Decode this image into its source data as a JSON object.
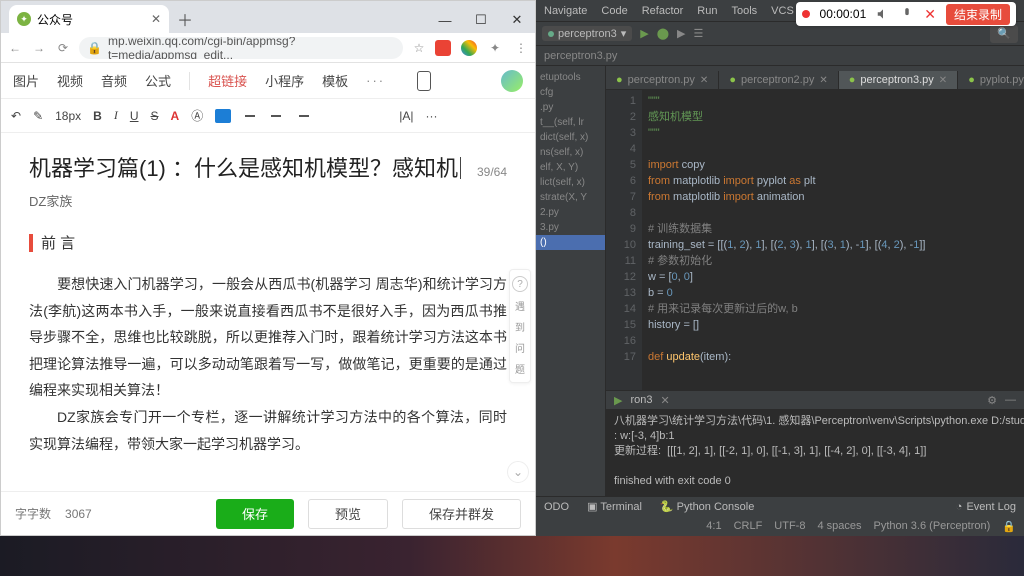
{
  "recording": {
    "time": "00:00:01",
    "stop_label": "结束录制"
  },
  "browser": {
    "tab": {
      "title": "公众号"
    },
    "url": "mp.weixin.qq.com/cgi-bin/appmsg?t=media/appmsg_edit...",
    "toolbar": {
      "image": "图片",
      "video": "视频",
      "audio": "音频",
      "formula": "公式",
      "link": "超链接",
      "miniprog": "小程序",
      "template": "模板",
      "more": "···"
    },
    "format": {
      "font_size": "18px",
      "bold": "B",
      "italic": "I",
      "underline": "U",
      "strike": "S",
      "colorA": "A",
      "more": "···"
    },
    "doc": {
      "title": "机器学习篇(1) ：什么是感知机模型？感知机",
      "counter": "39/64",
      "author": "DZ家族",
      "section": "前 言",
      "p1_a": "要想快速入门机器学习，一般会从西瓜书(机器学习 周志华)和统计学习方法(李航)这两本书入手，一般来说直接看西瓜书不是很好入手，因为西瓜书推导步骤不全，思维也比较跳脱，所以更推荐入门时，跟着统计学习方法这本书把理论算法推导一遍，可以多动动笔跟着写一写，做做笔记，更重要的是通过编程来实现相关算法！",
      "p1_b": "DZ家族会专门开一个专栏，逐一讲解统计学习方法中的各个算法，同时实现算法编程，带领大家一起学习机器学习。",
      "sidebar": {
        "q": "?",
        "t1": "遇",
        "t2": "到",
        "t3": "问",
        "t4": "题"
      }
    },
    "bottom": {
      "wc_label": "字字数",
      "wc": "3067",
      "save": "保存",
      "preview": "预览",
      "save_send": "保存并群发"
    }
  },
  "ide": {
    "menus": [
      "Navigate",
      "Code",
      "Refactor",
      "Run",
      "Tools",
      "VCS"
    ],
    "run_config": "perceptron3",
    "breadcrumb": "perceptron3.py",
    "project_items": [
      "etuptools",
      "cfg",
      ".py",
      "t__(self, lr",
      "dict(self, x)",
      "ns(self, x)",
      "elf, X, Y)",
      "lict(self, x)",
      "strate(X, Y",
      "2.py",
      "3.py",
      "()"
    ],
    "project_selected_index": 11,
    "tabs": [
      {
        "name": "perceptron.py",
        "active": false
      },
      {
        "name": "perceptron2.py",
        "active": false
      },
      {
        "name": "perceptron3.py",
        "active": true
      },
      {
        "name": "pyplot.py",
        "active": false
      }
    ],
    "code": {
      "line_start": 1,
      "lines": [
        {
          "t": "doc",
          "v": "\"\"\""
        },
        {
          "t": "doc",
          "v": "感知机模型"
        },
        {
          "t": "doc",
          "v": "\"\"\""
        },
        {
          "t": "blank",
          "v": ""
        },
        {
          "t": "imp",
          "v": "import copy"
        },
        {
          "t": "imp2",
          "v": "from matplotlib import pyplot as plt"
        },
        {
          "t": "imp2",
          "v": "from matplotlib import animation"
        },
        {
          "t": "blank",
          "v": ""
        },
        {
          "t": "cmt",
          "v": "# 训练数据集"
        },
        {
          "t": "code",
          "v": "training_set = [[(1, 2), 1], [(2, 3), 1], [(3, 1), -1], [(4, 2), -1]]"
        },
        {
          "t": "cmt",
          "v": "# 参数初始化"
        },
        {
          "t": "code",
          "v": "w = [0, 0]"
        },
        {
          "t": "code",
          "v": "b = 0"
        },
        {
          "t": "cmt",
          "v": "# 用来记录每次更新过后的w, b"
        },
        {
          "t": "code",
          "v": "history = []"
        },
        {
          "t": "blank",
          "v": ""
        },
        {
          "t": "def",
          "v": "def update(item):"
        }
      ]
    },
    "run_tab_label": "ron3",
    "console_lines": [
      "八机器学习\\统计学习方法\\代码\\1. 感知器\\Perceptron\\venv\\Scripts\\python.exe D:/study/机器学习",
      ": w:[-3, 4]b:1",
      "更新过程:  [[[1, 2], 1], [[-2, 1], 0], [[-1, 3], 1], [[-4, 2], 0], [[-3, 4], 1]]",
      "",
      "finished with exit code 0"
    ],
    "tool_windows": {
      "todo": "ODO",
      "terminal": "Terminal",
      "pyconsole": "Python Console",
      "eventlog": "Event Log"
    },
    "status": {
      "pos": "4:1",
      "crlf": "CRLF",
      "enc": "UTF-8",
      "indent": "4 spaces",
      "interp": "Python 3.6 (Perceptron)"
    }
  }
}
